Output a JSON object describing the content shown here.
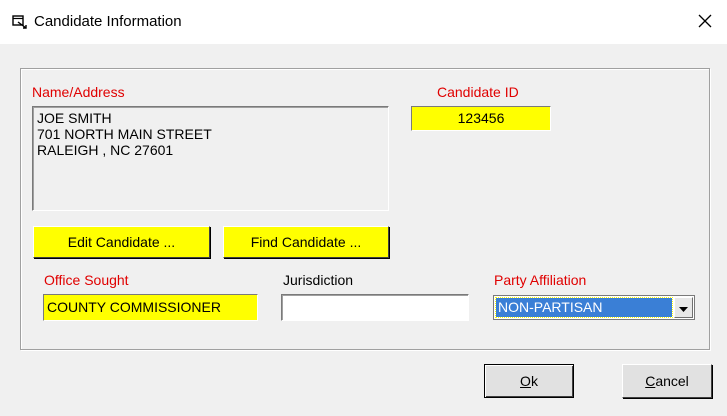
{
  "window": {
    "title": "Candidate Information",
    "close_glyph": "✕"
  },
  "name_address": {
    "label": "Name/Address",
    "lines": [
      "JOE SMITH",
      "701 NORTH MAIN STREET",
      "RALEIGH , NC 27601"
    ]
  },
  "candidate_id": {
    "label": "Candidate ID",
    "value": "123456"
  },
  "buttons": {
    "edit_candidate": "Edit Candidate ...",
    "find_candidate": "Find Candidate ...",
    "ok_accel": "O",
    "ok_rest": "k",
    "cancel_accel": "C",
    "cancel_rest": "ancel"
  },
  "office_sought": {
    "label": "Office Sought",
    "value": "COUNTY COMMISSIONER"
  },
  "jurisdiction": {
    "label": "Jurisdiction",
    "value": ""
  },
  "party_affiliation": {
    "label": "Party Affiliation",
    "value": "NON-PARTISAN"
  },
  "colors": {
    "required_label": "#e00000",
    "field_highlight": "#ffff00",
    "selection": "#3a7fd6"
  },
  "icons": {
    "window_icon": "window-app-icon",
    "close": "close-icon",
    "dropdown": "chevron-down-icon"
  }
}
